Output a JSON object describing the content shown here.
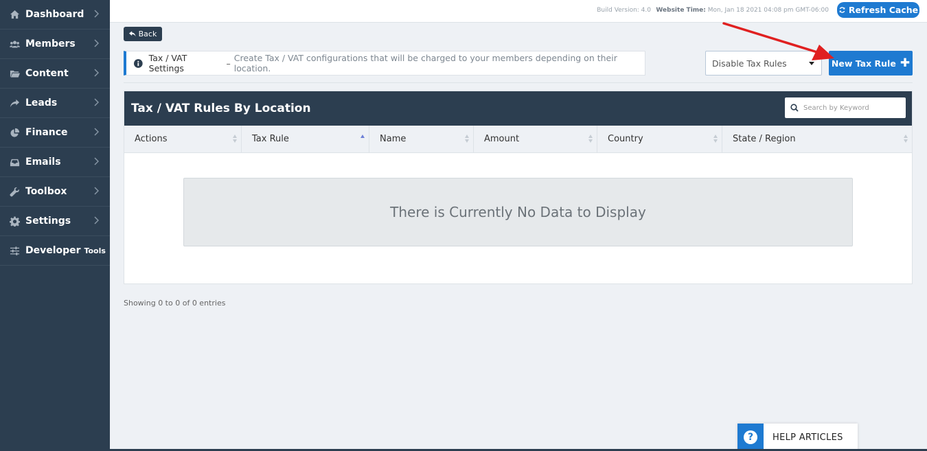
{
  "sidebar": {
    "items": [
      {
        "label": "Dashboard",
        "icon": "home-icon"
      },
      {
        "label": "Members",
        "icon": "users-icon"
      },
      {
        "label": "Content",
        "icon": "folder-icon"
      },
      {
        "label": "Leads",
        "icon": "share-icon"
      },
      {
        "label": "Finance",
        "icon": "pie-chart-icon"
      },
      {
        "label": "Emails",
        "icon": "inbox-icon"
      },
      {
        "label": "Toolbox",
        "icon": "wrench-icon"
      },
      {
        "label": "Settings",
        "icon": "gear-icon"
      },
      {
        "label": "Developer",
        "label_small": "Tools",
        "icon": "sliders-icon"
      }
    ]
  },
  "topbar": {
    "build_version": "Build Version: 4.0",
    "website_time_label": "Website Time:",
    "website_time_value": "Mon, Jan 18 2021 04:08 pm GMT-06:00",
    "refresh_label": "Refresh Cache"
  },
  "page": {
    "back_label": "Back",
    "info_title": "Tax / VAT Settings",
    "info_sep": "–",
    "info_desc": "Create Tax / VAT configurations that will be charged to your members depending on their location.",
    "select_value": "Disable Tax Rules",
    "new_button_label": "New Tax Rule",
    "showing_text": "Showing 0 to 0 of 0 entries"
  },
  "table": {
    "title": "Tax / VAT Rules By Location",
    "search_placeholder": "Search by Keyword",
    "columns": [
      "Actions",
      "Tax Rule",
      "Name",
      "Amount",
      "Country",
      "State / Region"
    ],
    "sorted_column": "Tax Rule",
    "empty_message": "There is Currently No Data to Display"
  },
  "help": {
    "label": "HELP ARTICLES"
  },
  "colors": {
    "sidebar_bg": "#2c3e50",
    "accent": "#1e7ad1",
    "annotation_arrow": "#e02020"
  }
}
